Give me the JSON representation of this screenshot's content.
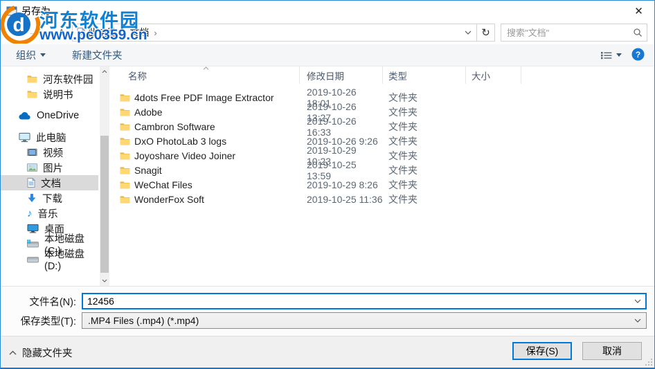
{
  "window": {
    "title": "另存为"
  },
  "icons": {
    "close": "✕",
    "back": "←",
    "forward": "→",
    "up": "↑",
    "refresh": "↻",
    "crumb_sep": "›",
    "music_note": "♪"
  },
  "watermark": {
    "site_name": "河东软件园",
    "site_url": "www.pc0359.cn"
  },
  "address": {
    "crumbs": [
      {
        "label": "此电脑"
      },
      {
        "label": "文档"
      }
    ],
    "search_placeholder": "搜索\"文档\""
  },
  "toolbar": {
    "organize": "组织",
    "new_folder": "新建文件夹"
  },
  "sidebar": {
    "items": [
      {
        "label": "河东软件园"
      },
      {
        "label": "说明书"
      },
      {
        "label": "OneDrive"
      },
      {
        "label": "此电脑"
      },
      {
        "label": "视频"
      },
      {
        "label": "图片"
      },
      {
        "label": "文档"
      },
      {
        "label": "下载"
      },
      {
        "label": "音乐"
      },
      {
        "label": "桌面"
      },
      {
        "label": "本地磁盘 (C:)"
      },
      {
        "label": "本地磁盘 (D:)"
      }
    ]
  },
  "files": {
    "columns": {
      "name": "名称",
      "date": "修改日期",
      "type": "类型",
      "size": "大小"
    },
    "rows": [
      {
        "name": "4dots Free PDF Image Extractor",
        "date": "2019-10-26 18:01",
        "type": "文件夹"
      },
      {
        "name": "Adobe",
        "date": "2019-10-26 13:27",
        "type": "文件夹"
      },
      {
        "name": "Cambron Software",
        "date": "2019-10-26 16:33",
        "type": "文件夹"
      },
      {
        "name": "DxO PhotoLab 3 logs",
        "date": "2019-10-26 9:26",
        "type": "文件夹"
      },
      {
        "name": "Joyoshare Video Joiner",
        "date": "2019-10-29 10:23",
        "type": "文件夹"
      },
      {
        "name": "Snagit",
        "date": "2019-10-25 13:59",
        "type": "文件夹"
      },
      {
        "name": "WeChat Files",
        "date": "2019-10-29 8:26",
        "type": "文件夹"
      },
      {
        "name": "WonderFox Soft",
        "date": "2019-10-25 11:36",
        "type": "文件夹"
      }
    ]
  },
  "footer": {
    "filename_label": "文件名(N):",
    "filename_value": "12456",
    "filetype_label": "保存类型(T):",
    "filetype_value": ".MP4 Files (.mp4) (*.mp4)"
  },
  "bottom": {
    "hide_folders": "隐藏文件夹",
    "save": "保存(S)",
    "cancel": "取消"
  },
  "colors": {
    "accent": "#0078d7",
    "folder": "#ffd873",
    "selection": "#dadada"
  }
}
